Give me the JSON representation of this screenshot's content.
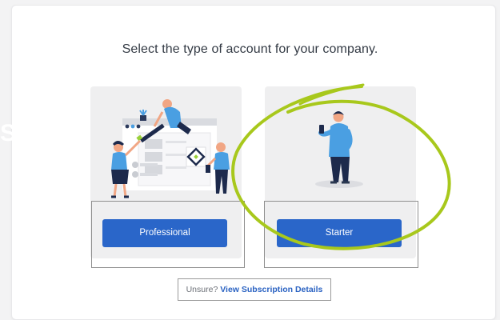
{
  "page": {
    "heading": "Select the type of account for your company.",
    "ghost_text": "Sier"
  },
  "plans": [
    {
      "label": "Professional"
    },
    {
      "label": "Starter"
    }
  ],
  "subscription_link": {
    "prefix": "Unsure?",
    "link_text": "View Subscription Details"
  },
  "colors": {
    "primary_button": "#2a66c9",
    "highlight_scribble": "#a8c81c",
    "figure_blue": "#4a9fe2",
    "figure_navy": "#1d2a4c"
  },
  "icons": {
    "professional_illustration": "team-collaborating-illustration",
    "starter_illustration": "person-with-phone-illustration"
  }
}
